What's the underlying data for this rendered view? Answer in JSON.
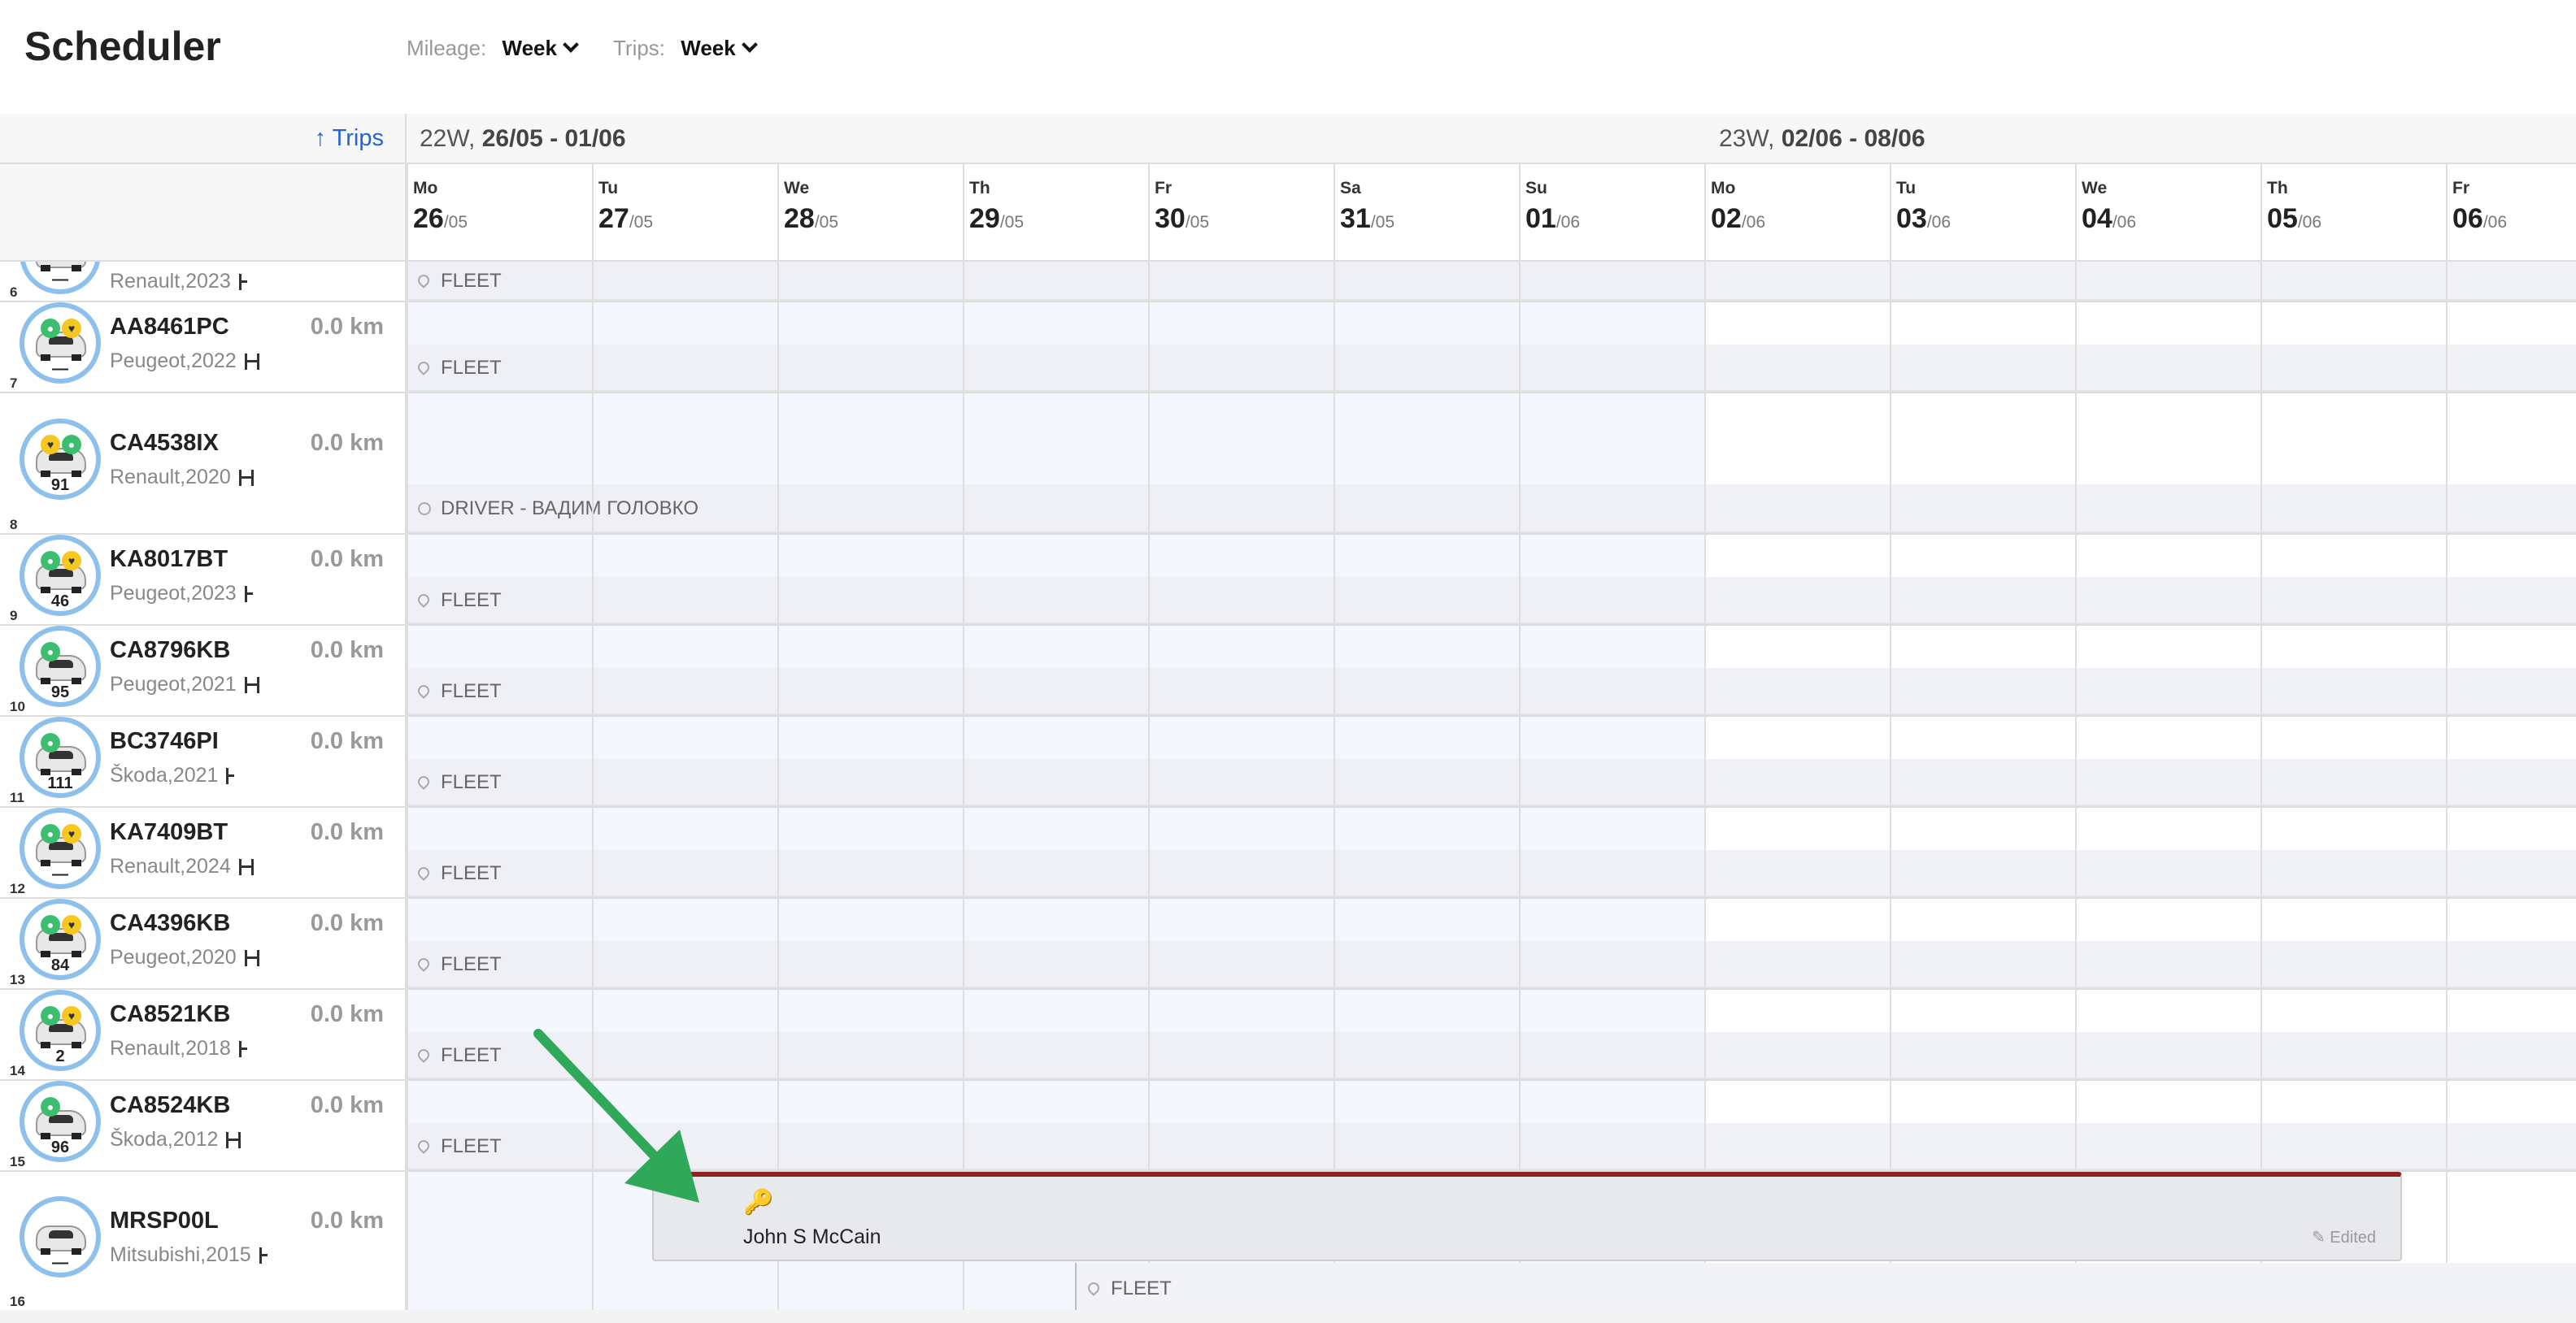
{
  "app": {
    "title": "Scheduler"
  },
  "filters": [
    {
      "label": "Mileage:",
      "value": "Week"
    },
    {
      "label": "Trips:",
      "value": "Week"
    }
  ],
  "sort_link": "↑ Trips",
  "weeks": [
    {
      "num": "22W,",
      "range": "26/05 - 01/06"
    },
    {
      "num": "23W,",
      "range": "02/06 - 08/06"
    }
  ],
  "days": [
    {
      "name": "Mo",
      "day": "26",
      "month": "/05"
    },
    {
      "name": "Tu",
      "day": "27",
      "month": "/05"
    },
    {
      "name": "We",
      "day": "28",
      "month": "/05"
    },
    {
      "name": "Th",
      "day": "29",
      "month": "/05"
    },
    {
      "name": "Fr",
      "day": "30",
      "month": "/05"
    },
    {
      "name": "Sa",
      "day": "31",
      "month": "/05"
    },
    {
      "name": "Su",
      "day": "01",
      "month": "/06"
    },
    {
      "name": "Mo",
      "day": "02",
      "month": "/06"
    },
    {
      "name": "Tu",
      "day": "03",
      "month": "/06"
    },
    {
      "name": "We",
      "day": "04",
      "month": "/06"
    },
    {
      "name": "Th",
      "day": "05",
      "month": "/06"
    },
    {
      "name": "Fr",
      "day": "06",
      "month": "/06"
    }
  ],
  "vehicles": [
    {
      "num": "6",
      "plate": "",
      "km": "",
      "model": "Renault,2023",
      "gear": "auto",
      "avatar_num": "—",
      "badges": []
    },
    {
      "num": "7",
      "plate": "AA8461PC",
      "km": "0.0 km",
      "model": "Peugeot,2022",
      "gear": "manual",
      "avatar_num": "—",
      "badges": [
        "green",
        "yellow"
      ]
    },
    {
      "num": "8",
      "plate": "CA4538IX",
      "km": "0.0 km",
      "model": "Renault,2020",
      "gear": "manual",
      "avatar_num": "91",
      "badges": [
        "yellow",
        "green"
      ]
    },
    {
      "num": "9",
      "plate": "KA8017BT",
      "km": "0.0 km",
      "model": "Peugeot,2023",
      "gear": "auto",
      "avatar_num": "46",
      "badges": [
        "green",
        "yellow"
      ]
    },
    {
      "num": "10",
      "plate": "CA8796KB",
      "km": "0.0 km",
      "model": "Peugeot,2021",
      "gear": "manual",
      "avatar_num": "95",
      "badges": [
        "green"
      ]
    },
    {
      "num": "11",
      "plate": "BC3746PI",
      "km": "0.0 km",
      "model": "Škoda,2021",
      "gear": "auto",
      "avatar_num": "111",
      "badges": [
        "green"
      ]
    },
    {
      "num": "12",
      "plate": "KA7409BT",
      "km": "0.0 km",
      "model": "Renault,2024",
      "gear": "manual",
      "avatar_num": "—",
      "badges": [
        "green",
        "yellow"
      ]
    },
    {
      "num": "13",
      "plate": "CA4396KB",
      "km": "0.0 km",
      "model": "Peugeot,2020",
      "gear": "manual",
      "avatar_num": "84",
      "badges": [
        "green",
        "yellow"
      ]
    },
    {
      "num": "14",
      "plate": "CA8521KB",
      "km": "0.0 km",
      "model": "Renault,2018",
      "gear": "auto",
      "avatar_num": "2",
      "badges": [
        "green",
        "yellow"
      ]
    },
    {
      "num": "15",
      "plate": "CA8524KB",
      "km": "0.0 km",
      "model": "Škoda,2012",
      "gear": "manual",
      "avatar_num": "96",
      "badges": [
        "green"
      ]
    },
    {
      "num": "16",
      "plate": "MRSP00L",
      "km": "0.0 km",
      "model": "Mitsubishi,2015",
      "gear": "auto",
      "avatar_num": "—",
      "badges": []
    }
  ],
  "lanes": [
    {
      "type": "fleet",
      "label": "FLEET"
    },
    {
      "type": "fleet",
      "label": "FLEET"
    },
    {
      "type": "driver",
      "label": "DRIVER - ВАДИМ ГОЛОВКО"
    },
    {
      "type": "fleet",
      "label": "FLEET"
    },
    {
      "type": "fleet",
      "label": "FLEET"
    },
    {
      "type": "fleet",
      "label": "FLEET"
    },
    {
      "type": "fleet",
      "label": "FLEET"
    },
    {
      "type": "fleet",
      "label": "FLEET"
    },
    {
      "type": "fleet",
      "label": "FLEET"
    },
    {
      "type": "fleet",
      "label": "FLEET"
    }
  ],
  "booking": {
    "driver": "John S McCain",
    "status": "Edited"
  },
  "bottom_lane": {
    "label": "FLEET"
  },
  "colors": {
    "booking_bar": "#8b2525",
    "link": "#2563d6",
    "avatar_ring": "#8ec0ee",
    "annotation_arrow": "#2fa85a"
  }
}
